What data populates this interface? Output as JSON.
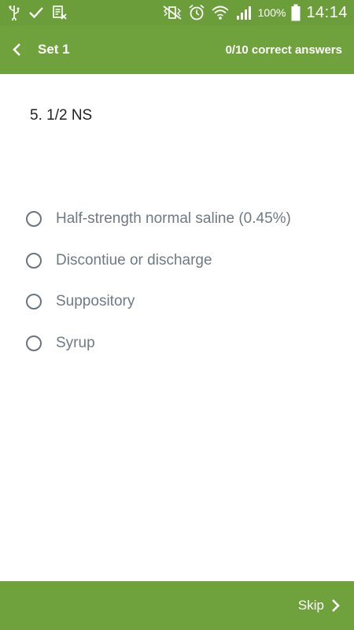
{
  "status_bar": {
    "left_icons": [
      "usb-icon",
      "check-icon",
      "document-x-icon"
    ],
    "right_icons": [
      "vibrate-mute-icon",
      "alarm-icon",
      "wifi-icon",
      "signal-icon",
      "battery-icon"
    ],
    "battery_percent": "100%",
    "time": "14:14"
  },
  "app_bar": {
    "title": "Set 1",
    "score": "0/10 correct answers"
  },
  "question": {
    "text": "5. 1/2 NS"
  },
  "options": [
    {
      "label": "Half-strength normal saline (0.45%)"
    },
    {
      "label": "Discontiue or discharge"
    },
    {
      "label": "Suppository"
    },
    {
      "label": "Syrup"
    }
  ],
  "bottom_bar": {
    "skip_label": "Skip"
  },
  "colors": {
    "status_bar": "#6b9e3a",
    "app_bar": "#6fa23d",
    "option_text": "#6f7a85",
    "radio_border": "#6b7580"
  }
}
